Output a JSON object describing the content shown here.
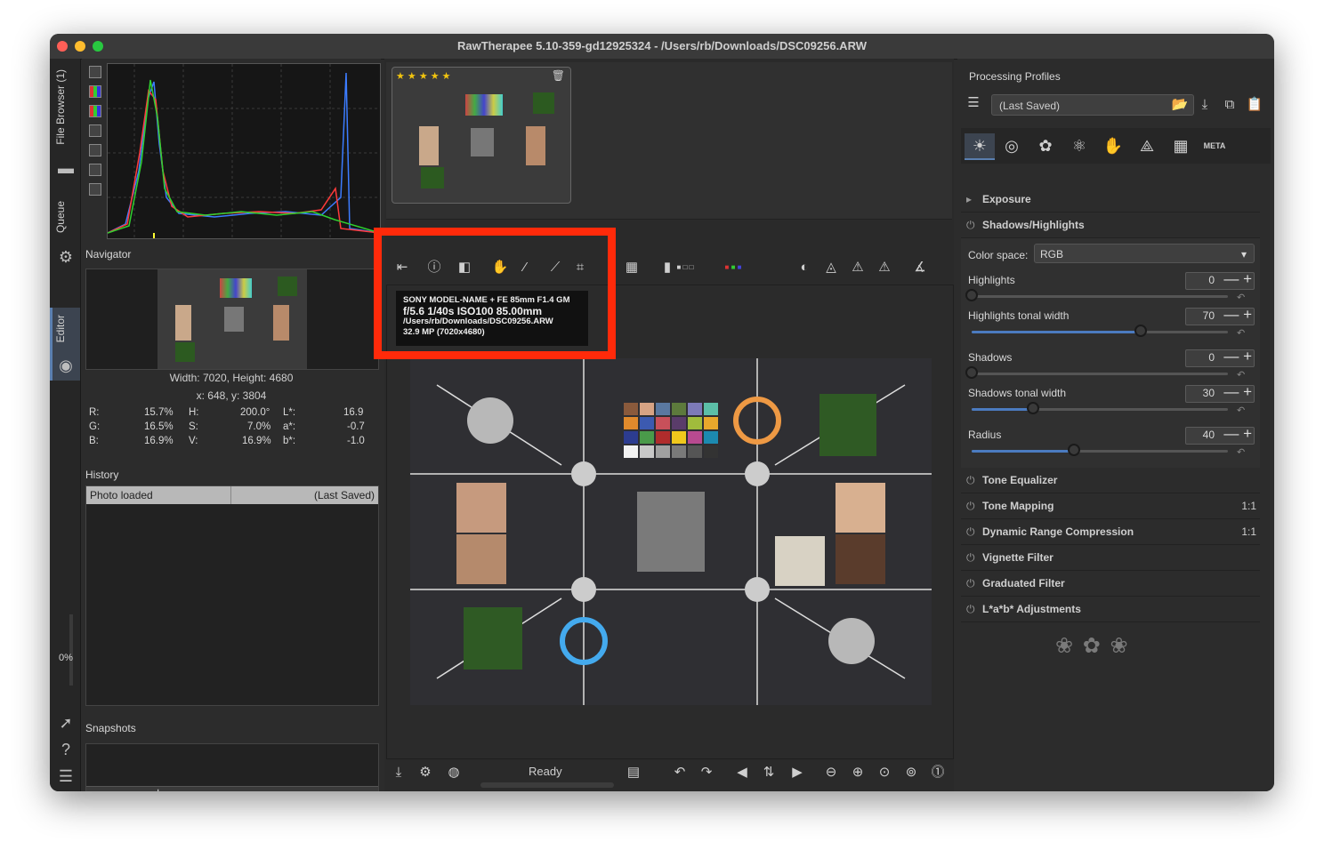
{
  "window": {
    "title": "RawTherapee 5.10-359-gd12925324 - /Users/rb/Downloads/DSC09256.ARW"
  },
  "sidebar": {
    "file_browser": "File Browser (1)",
    "queue": "Queue",
    "editor": "Editor",
    "percent": "0%"
  },
  "left": {
    "navigator_label": "Navigator",
    "dims": "Width: 7020, Height: 4680",
    "coords": "x: 648, y: 3804",
    "values": [
      {
        "k1": "R:",
        "v1": "15.7%",
        "k2": "H:",
        "v2": "200.0°",
        "k3": "L*:",
        "v3": "16.9"
      },
      {
        "k1": "G:",
        "v1": "16.5%",
        "k2": "S:",
        "v2": "7.0%",
        "k3": "a*:",
        "v3": "-0.7"
      },
      {
        "k1": "B:",
        "v1": "16.9%",
        "k2": "V:",
        "v2": "16.9%",
        "k3": "b*:",
        "v3": "-1.0"
      }
    ],
    "history_label": "History",
    "history_row": {
      "name": "Photo loaded",
      "value": "(Last Saved)"
    },
    "snapshots_label": "Snapshots",
    "snap_add": "+",
    "snap_remove": "−"
  },
  "center": {
    "stars": "★ ★ ★ ★ ★",
    "info": {
      "line1": "SONY MODEL-NAME + FE 85mm F1.4 GM",
      "line2": "f/5.6  1/40s  ISO100  85.00mm",
      "line3": "/Users/rb/Downloads/DSC09256.ARW",
      "line4": "32.9 MP (7020x4680)"
    },
    "status": "Ready"
  },
  "right": {
    "processing_profiles": "Processing Profiles",
    "profile_value": "(Last Saved)",
    "meta_tab": "META",
    "sections_top": [
      {
        "name": "Exposure"
      },
      {
        "name": "Shadows/Highlights"
      }
    ],
    "color_space_label": "Color space:",
    "color_space_value": "RGB",
    "sliders": [
      {
        "label": "Highlights",
        "value": "0",
        "fraction": 0.0
      },
      {
        "label": "Highlights tonal width",
        "value": "70",
        "fraction": 0.66
      },
      {
        "label": "Shadows",
        "value": "0",
        "fraction": 0.0
      },
      {
        "label": "Shadows tonal width",
        "value": "30",
        "fraction": 0.24
      },
      {
        "label": "Radius",
        "value": "40",
        "fraction": 0.4
      }
    ],
    "sections": [
      {
        "name": "Tone Equalizer",
        "badge": ""
      },
      {
        "name": "Tone Mapping",
        "badge": "1:1"
      },
      {
        "name": "Dynamic Range Compression",
        "badge": "1:1"
      },
      {
        "name": "Vignette Filter",
        "badge": ""
      },
      {
        "name": "Graduated Filter",
        "badge": ""
      },
      {
        "name": "L*a*b* Adjustments",
        "badge": ""
      }
    ]
  },
  "colors": {
    "highlight_frame": "#ff2a0a",
    "slider_fill": "#4b7bc0"
  }
}
